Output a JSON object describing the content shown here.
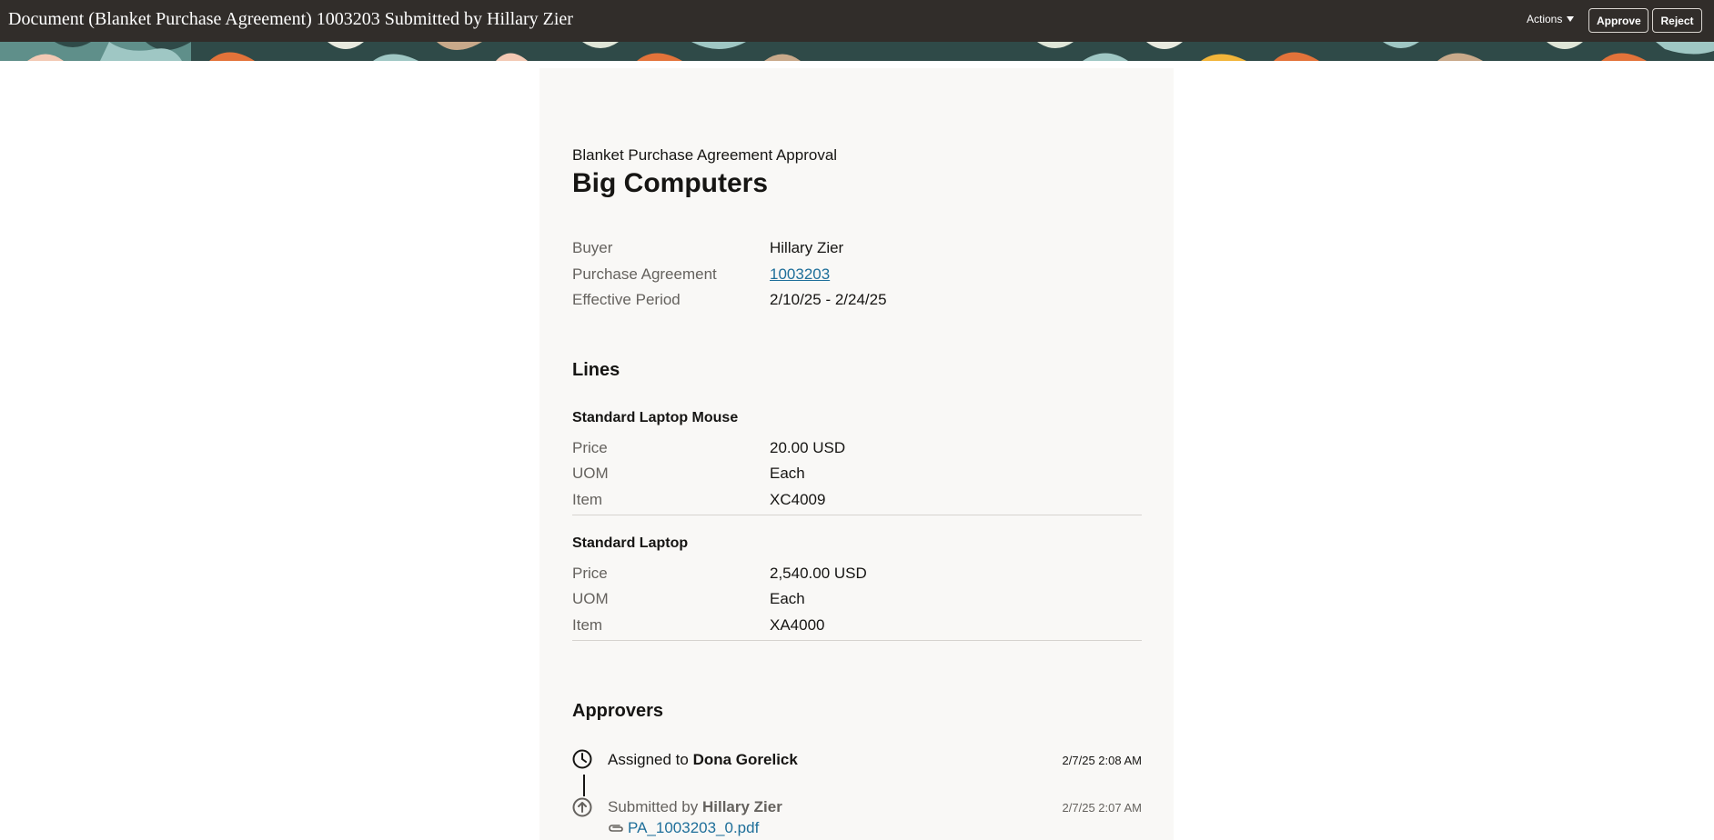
{
  "header": {
    "title": "Document (Blanket Purchase Agreement) 1003203 Submitted by Hillary Zier",
    "actions_label": "Actions",
    "approve_label": "Approve",
    "reject_label": "Reject"
  },
  "card": {
    "subtitle": "Blanket Purchase Agreement Approval",
    "title": "Big Computers",
    "summary": [
      {
        "label": "Buyer",
        "value": "Hillary Zier"
      },
      {
        "label": "Purchase Agreement",
        "value": "1003203"
      },
      {
        "label": "Effective Period",
        "value": "2/10/25 - 2/24/25"
      }
    ]
  },
  "lines": {
    "heading": "Lines",
    "items": [
      {
        "name": "Standard Laptop Mouse",
        "fields": [
          {
            "label": "Price",
            "value": "20.00 USD"
          },
          {
            "label": "UOM",
            "value": "Each"
          },
          {
            "label": "Item",
            "value": "XC4009"
          }
        ]
      },
      {
        "name": "Standard Laptop",
        "fields": [
          {
            "label": "Price",
            "value": "2,540.00 USD"
          },
          {
            "label": "UOM",
            "value": "Each"
          },
          {
            "label": "Item",
            "value": "XA4000"
          }
        ]
      }
    ]
  },
  "approvers": {
    "heading": "Approvers",
    "entries": [
      {
        "action": "Assigned to",
        "person": "Dona Gorelick",
        "time": "2/7/25 2:08 AM",
        "icon": "clock-icon"
      },
      {
        "action": "Submitted by",
        "person": "Hillary Zier",
        "time": "2/7/25 2:07 AM",
        "icon": "arrow-up-circle-icon",
        "attachment": "PA_1003203_0.pdf"
      }
    ]
  },
  "colors": {
    "header_bg": "#312d2a",
    "card_bg": "#f9f8f6",
    "link": "#1f6f9a",
    "banner_teal": "#5f8f8a",
    "banner_orange": "#e3733a"
  }
}
